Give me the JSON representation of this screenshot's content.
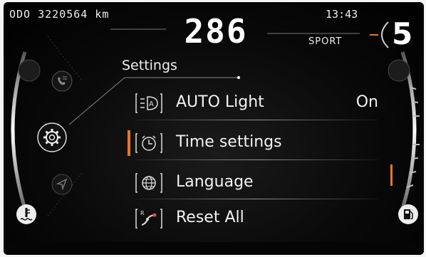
{
  "status": {
    "odometer": "ODO 3220564 km",
    "clock": "13:43",
    "speed": "286",
    "drive_mode": "SPORT",
    "gear": "5"
  },
  "menu": {
    "title": "Settings",
    "items": [
      {
        "label": "AUTO Light",
        "value": "On",
        "icon": "auto-light-icon",
        "selected": false
      },
      {
        "label": "Time settings",
        "value": "",
        "icon": "clock-icon",
        "selected": true
      },
      {
        "label": "Language",
        "value": "",
        "icon": "globe-icon",
        "selected": false
      },
      {
        "label": "Reset All",
        "value": "",
        "icon": "reset-icon",
        "selected": false
      }
    ]
  },
  "side_icons": [
    "phone-icon",
    "gear-icon",
    "navigation-icon",
    "coolant-temp-icon",
    "fuel-icon"
  ],
  "colors": {
    "accent": "#e8762c",
    "background": "#0a0a0a",
    "text": "#f0f0f0"
  }
}
